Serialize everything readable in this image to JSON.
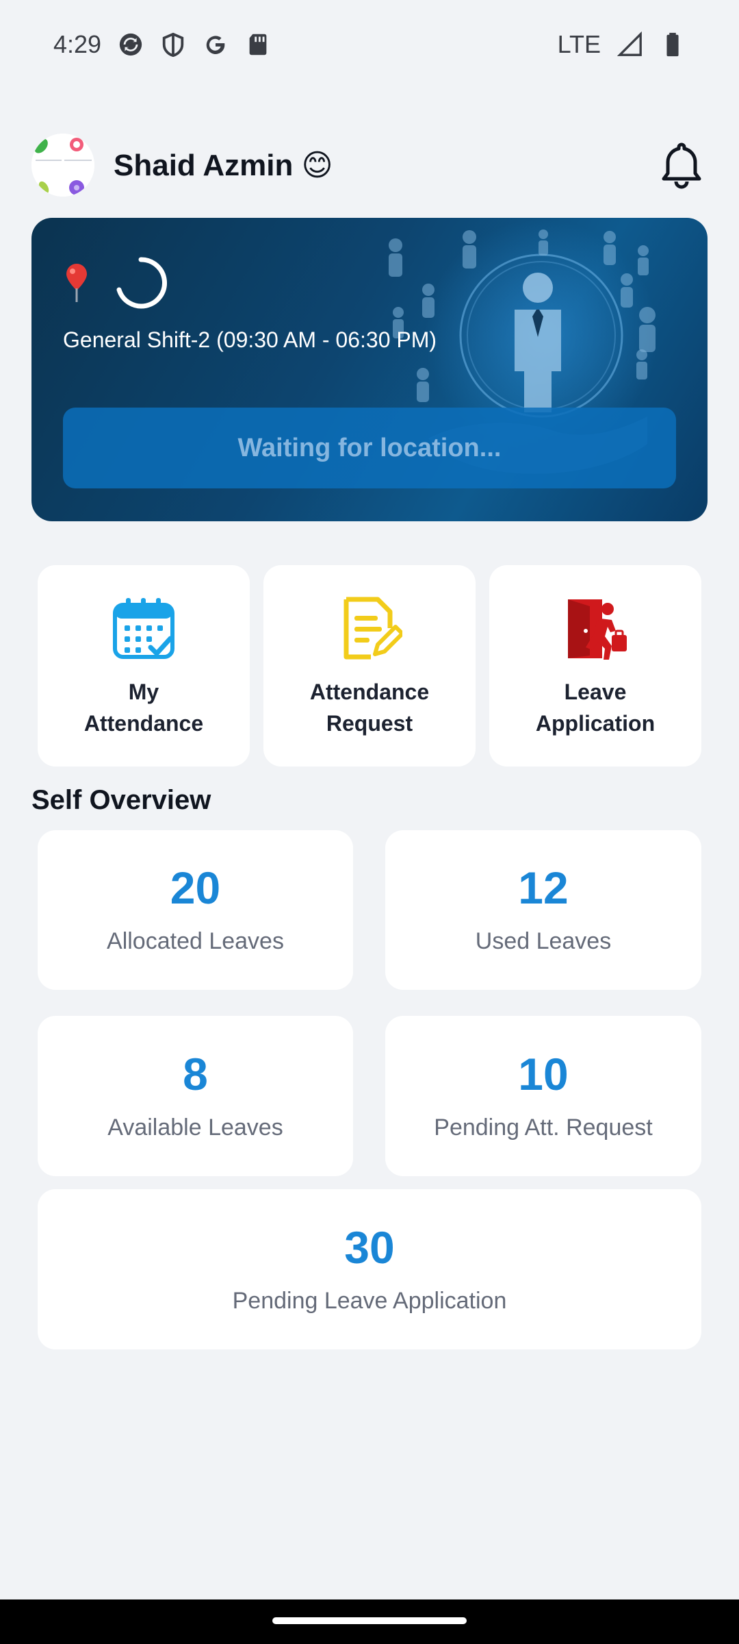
{
  "status_bar": {
    "time": "4:29",
    "network": "LTE",
    "icons": [
      "sync-icon",
      "shield-icon",
      "google-icon",
      "sd-card-icon",
      "signal-icon",
      "battery-icon"
    ]
  },
  "header": {
    "user_name": "Shaid Azmin 😊",
    "bell_icon": "bell-icon"
  },
  "hero": {
    "shift": "General Shift-2 (09:30 AM - 06:30 PM)",
    "location_button": "Waiting for location..."
  },
  "actions": [
    {
      "label": "My\nAttendance",
      "icon": "calendar-check-icon",
      "color": "#1aa3e8"
    },
    {
      "label": "Attendance\nRequest",
      "icon": "document-edit-icon",
      "color": "#f2cc1a"
    },
    {
      "label": "Leave\nApplication",
      "icon": "exit-door-icon",
      "color": "#d0191c"
    }
  ],
  "overview": {
    "title": "Self Overview",
    "stats": [
      {
        "value": "20",
        "label": "Allocated Leaves"
      },
      {
        "value": "12",
        "label": "Used Leaves"
      },
      {
        "value": "8",
        "label": "Available Leaves"
      },
      {
        "value": "10",
        "label": "Pending Att. Request"
      },
      {
        "value": "30",
        "label": "Pending Leave Application"
      }
    ]
  },
  "colors": {
    "accent": "#1a86d6",
    "background": "#f1f3f6",
    "hero": "#0d4570"
  }
}
